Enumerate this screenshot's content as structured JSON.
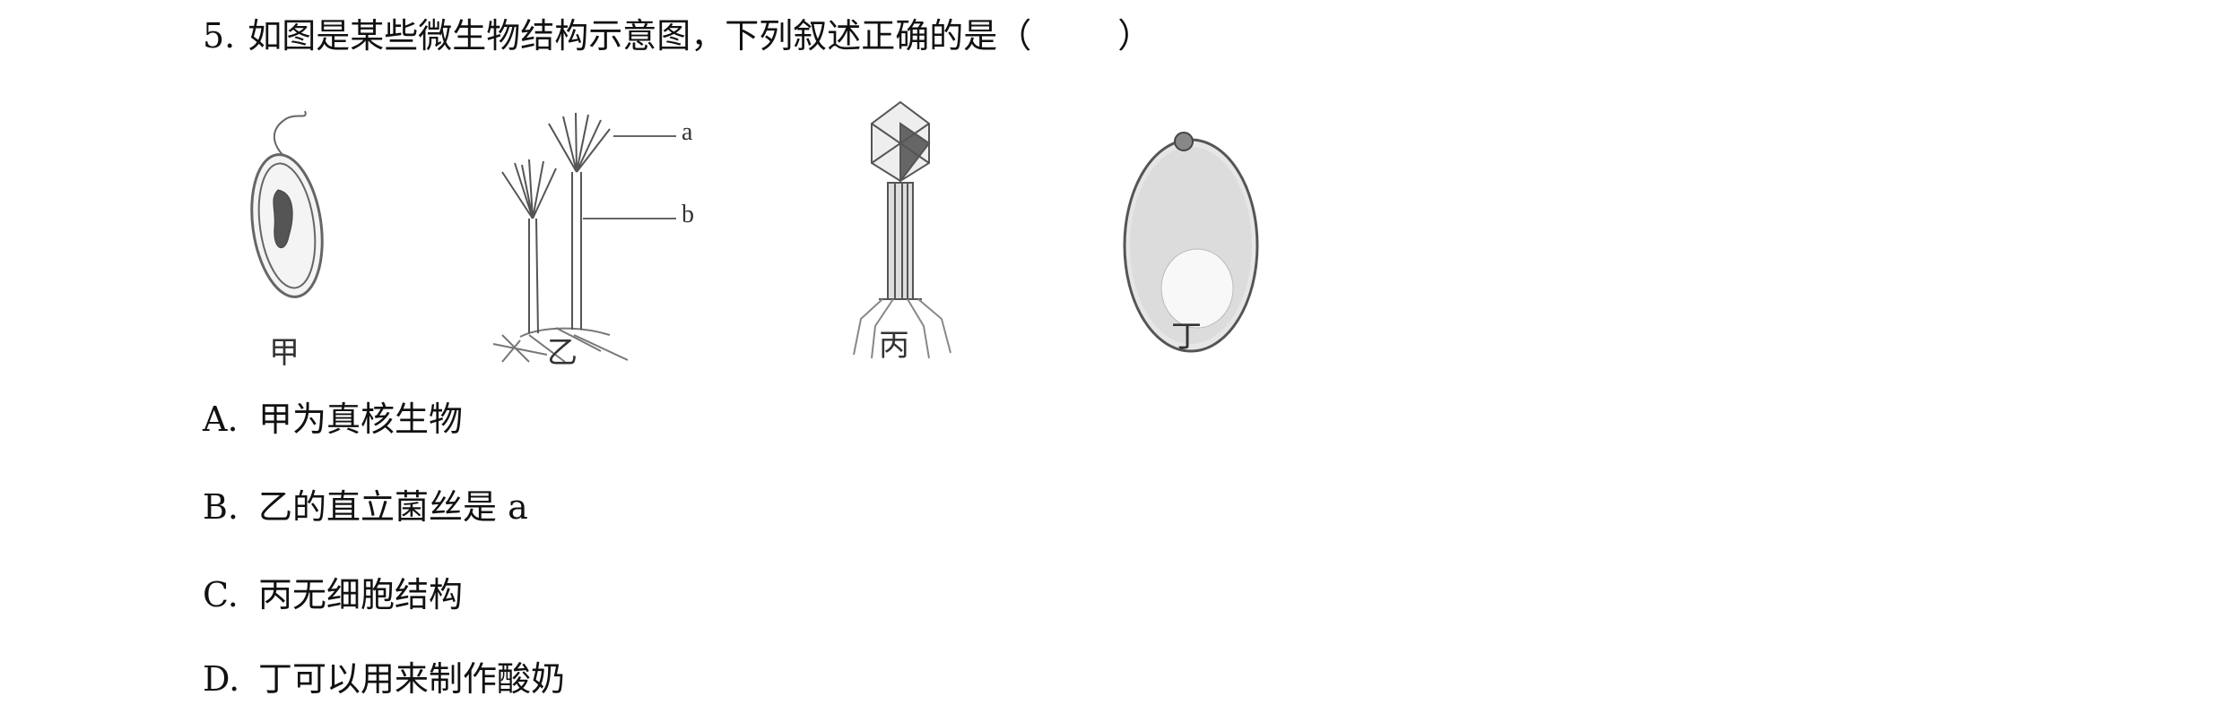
{
  "question": {
    "number": "5.",
    "stem": "如图是某些微生物结构示意图，下列叙述正确的是（",
    "close_paren": "）"
  },
  "figure": {
    "labels": [
      "甲",
      "乙",
      "丙",
      "丁"
    ],
    "part_labels": [
      "a",
      "b"
    ]
  },
  "options": [
    {
      "key": "A.",
      "text": "甲为真核生物"
    },
    {
      "key": "B.",
      "text": "乙的直立菌丝是 a"
    },
    {
      "key": "C.",
      "text": "丙无细胞结构"
    },
    {
      "key": "D.",
      "text": "丁可以用来制作酸奶"
    }
  ]
}
